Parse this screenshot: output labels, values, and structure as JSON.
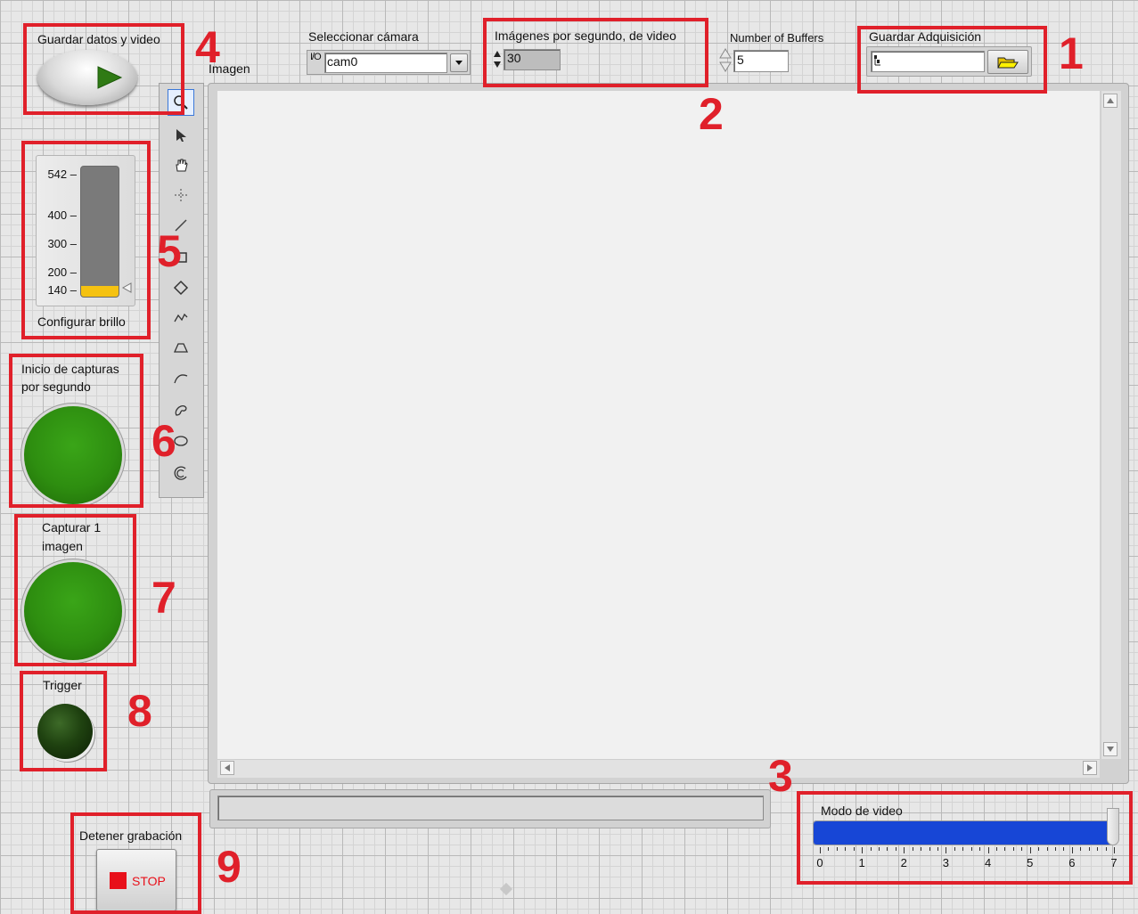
{
  "controls": {
    "save_data_video": {
      "label": "Guardar datos y video"
    },
    "image_display": {
      "label": "Imagen"
    },
    "camera_select": {
      "label": "Seleccionar cámara",
      "value": "cam0",
      "io_prefix": "I/O"
    },
    "fps": {
      "label": "Imágenes por segundo, de video",
      "value": "30"
    },
    "buffers": {
      "label": "Number of Buffers",
      "value": "5"
    },
    "save_acquisition": {
      "label": "Guardar Adquisición",
      "value": ""
    },
    "brightness": {
      "label": "Configurar brillo",
      "ticks": [
        "542",
        "400",
        "300",
        "200",
        "140"
      ],
      "value": 140,
      "min": 140,
      "max": 542
    },
    "start_capture": {
      "label_line1": "Inicio de capturas",
      "label_line2": "por segundo"
    },
    "capture_one": {
      "label_line1": "Capturar 1",
      "label_line2": "imagen"
    },
    "trigger": {
      "label": "Trigger"
    },
    "stop": {
      "label": "Detener grabación",
      "button": "STOP"
    },
    "video_mode": {
      "label": "Modo de video",
      "ticks": [
        "0",
        "1",
        "2",
        "3",
        "4",
        "5",
        "6",
        "7"
      ],
      "value": 7,
      "min": 0,
      "max": 7
    }
  },
  "annotations": [
    "1",
    "2",
    "3",
    "4",
    "5",
    "6",
    "7",
    "8",
    "9"
  ],
  "colors": {
    "annotation": "#e0202a",
    "led_on": "#2e8e10",
    "slider_fill": "#1746d6",
    "brightness_fill": "#f5c211",
    "stop_red": "#e8101a"
  }
}
